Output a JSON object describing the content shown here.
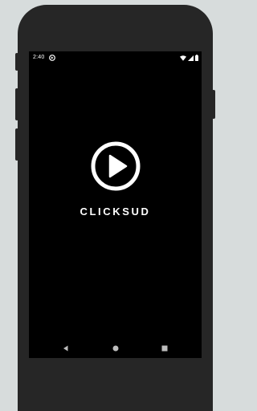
{
  "status_bar": {
    "time": "2:40",
    "app_icon": "app-notification-icon",
    "wifi_icon": "wifi-icon",
    "signal_icon": "signal-icon",
    "battery_icon": "battery-icon"
  },
  "splash": {
    "logo_icon": "play-circle-icon",
    "app_name": "CLICKSUD"
  },
  "nav_bar": {
    "back": "back-icon",
    "home": "home-icon",
    "recents": "recents-icon"
  },
  "colors": {
    "page_background": "#d7dcdc",
    "device_body": "#262626",
    "screen": "#000000",
    "foreground": "#ffffff",
    "nav_icons": "#bdbdbd"
  }
}
